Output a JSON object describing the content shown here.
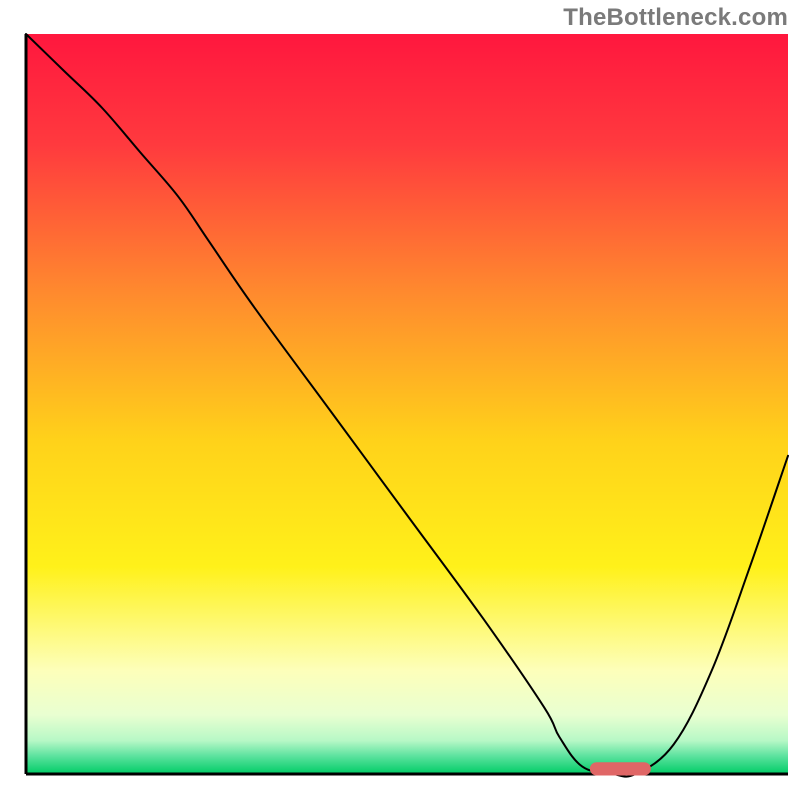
{
  "watermark": "TheBottleneck.com",
  "chart_data": {
    "type": "line",
    "title": "",
    "xlabel": "",
    "ylabel": "",
    "xlim": [
      0,
      100
    ],
    "ylim": [
      0,
      100
    ],
    "axes_visible": {
      "left": true,
      "bottom": true,
      "right": false,
      "top": false
    },
    "ticks_visible": false,
    "background": {
      "kind": "vertical-gradient",
      "stops": [
        {
          "pos": 0.0,
          "color": "#ff173e"
        },
        {
          "pos": 0.15,
          "color": "#ff3a3e"
        },
        {
          "pos": 0.35,
          "color": "#ff8a2e"
        },
        {
          "pos": 0.55,
          "color": "#ffd21a"
        },
        {
          "pos": 0.72,
          "color": "#fff11a"
        },
        {
          "pos": 0.86,
          "color": "#fdffba"
        },
        {
          "pos": 0.92,
          "color": "#e9ffd1"
        },
        {
          "pos": 0.955,
          "color": "#b7f8c6"
        },
        {
          "pos": 0.975,
          "color": "#5fe3a0"
        },
        {
          "pos": 1.0,
          "color": "#00cc66"
        }
      ]
    },
    "series": [
      {
        "name": "bottleneck-curve",
        "color": "#000000",
        "width": 2,
        "x": [
          0,
          5,
          10,
          15,
          20,
          24,
          30,
          40,
          50,
          60,
          68,
          70,
          73,
          77,
          80,
          85,
          90,
          95,
          100
        ],
        "y": [
          100,
          95,
          90,
          84,
          78,
          72,
          63,
          49,
          35,
          21,
          9,
          5,
          1,
          0,
          0,
          4,
          14,
          28,
          43
        ]
      }
    ],
    "marker": {
      "name": "optimal-range",
      "shape": "capsule",
      "color": "#e06666",
      "x_start": 74,
      "x_end": 82,
      "y": 0.7,
      "thickness_pct": 1.8
    }
  }
}
